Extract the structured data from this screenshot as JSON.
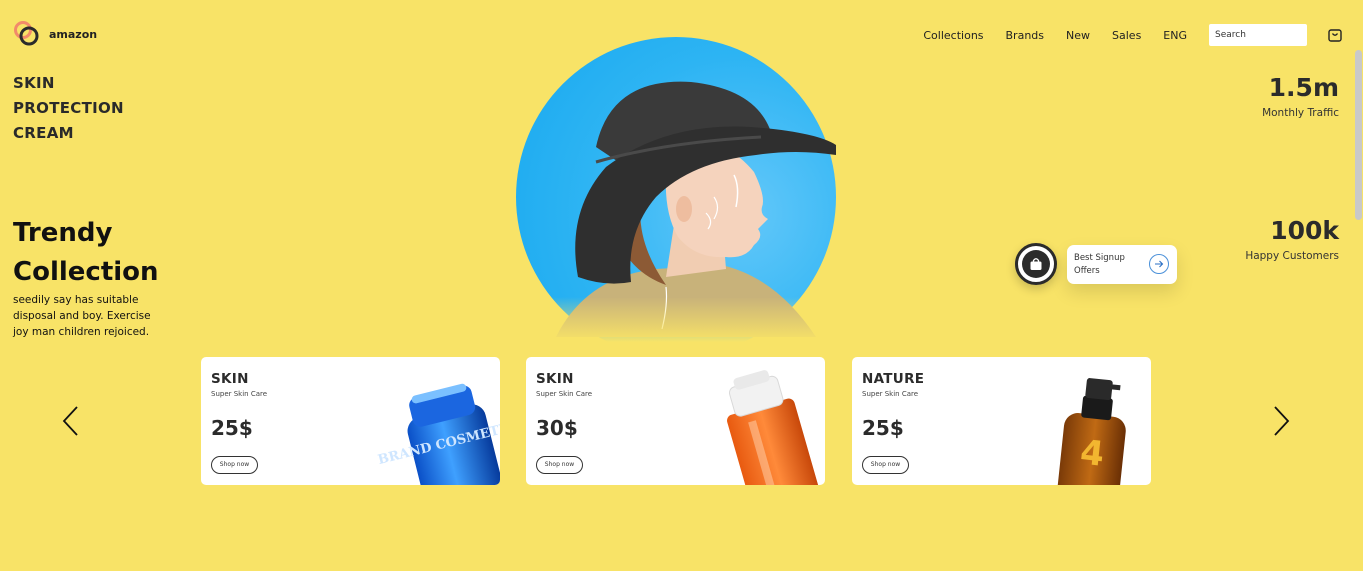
{
  "brand": {
    "name": "amazon",
    "logo_icon": "rings-logo-icon"
  },
  "nav": {
    "items": [
      "Collections",
      "Brands",
      "New",
      "Sales",
      "ENG"
    ],
    "search_placeholder": "Search",
    "cart_icon": "shopping-bag-icon"
  },
  "headline": {
    "lines": [
      "SKIN",
      "PROTECTION",
      "CREAM"
    ]
  },
  "trendy": {
    "title_line1": "Trendy",
    "title_line2": "Collection",
    "description": "seedily say has suitable disposal and boy. Exercise joy man children rejoiced."
  },
  "stats": [
    {
      "value": "1.5m",
      "label": "Monthly Traffic"
    },
    {
      "value": "100k",
      "label": "Happy Customers"
    }
  ],
  "signup": {
    "text": "Best Signup Offers",
    "bag_icon": "shopping-bag-icon",
    "arrow_icon": "arrow-right-icon"
  },
  "products": [
    {
      "category": "SKIN",
      "subtitle": "Super Skin Care",
      "price": "25$",
      "button": "Shop now",
      "image": "blue-cosmetic-bottle",
      "product_label": "BRAND COSMETICS"
    },
    {
      "category": "SKIN",
      "subtitle": "Super Skin Care",
      "price": "30$",
      "button": "Shop now",
      "image": "orange-serum-bottle"
    },
    {
      "category": "NATURE",
      "subtitle": "Super Skin Care",
      "price": "25$",
      "button": "Shop now",
      "image": "amber-spray-bottle"
    }
  ],
  "carousel": {
    "prev_icon": "chevron-left-icon",
    "next_icon": "chevron-right-icon"
  },
  "colors": {
    "background": "#F8E367",
    "hero_circle": "#2DB4F3",
    "card": "#FFFFFF",
    "text": "#1B1B1B"
  }
}
